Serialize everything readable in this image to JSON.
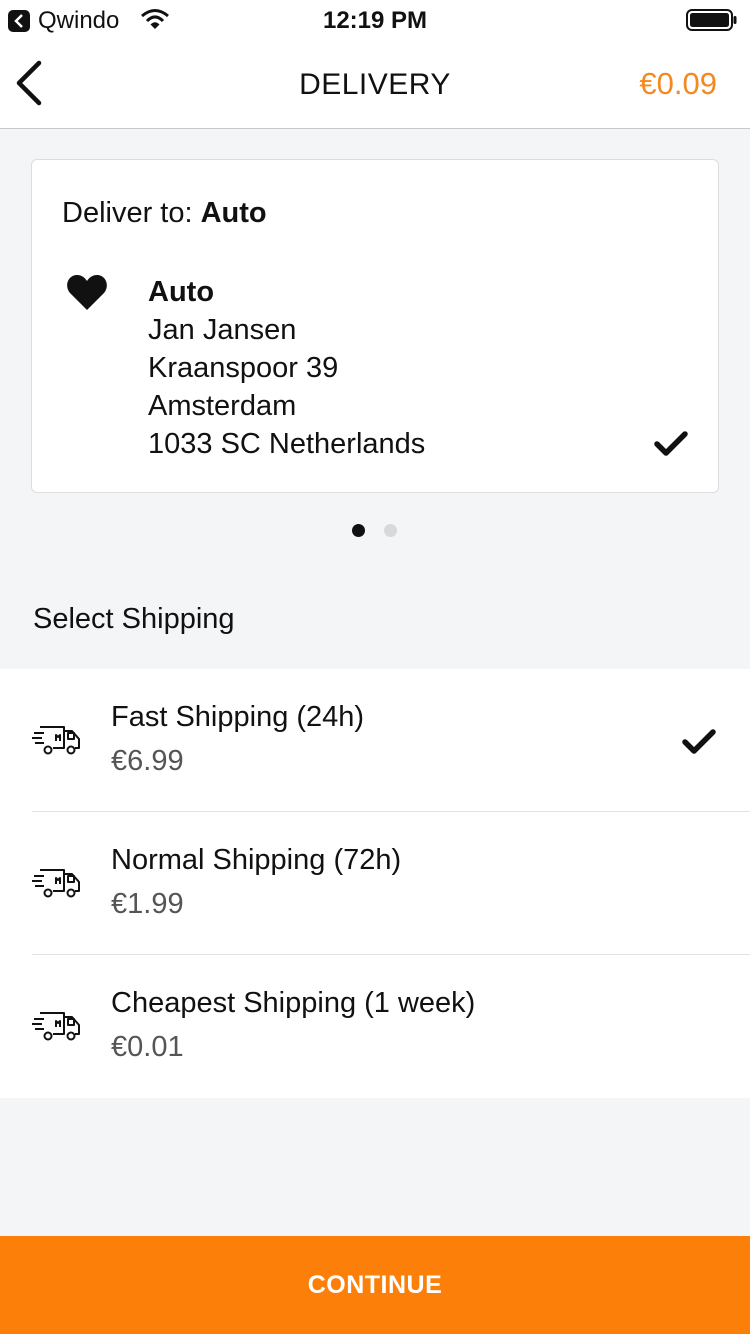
{
  "status_bar": {
    "app_name": "Qwindo",
    "time": "12:19 PM"
  },
  "nav": {
    "title": "DELIVERY",
    "total": "€0.09",
    "accent_color": "#f5891f"
  },
  "address_card": {
    "deliver_to_label": "Deliver to: ",
    "deliver_to_value": "Auto",
    "address": {
      "name": "Auto",
      "person": "Jan Jansen",
      "street": "Kraanspoor 39",
      "city": "Amsterdam",
      "postal_country": "1033 SC Netherlands"
    },
    "selected": true
  },
  "pager": {
    "pages": 2,
    "current": 1
  },
  "shipping": {
    "section_title": "Select Shipping",
    "options": [
      {
        "name": "Fast Shipping (24h)",
        "price": "€6.99",
        "selected": true
      },
      {
        "name": "Normal Shipping (72h)",
        "price": "€1.99",
        "selected": false
      },
      {
        "name": "Cheapest Shipping (1 week)",
        "price": "€0.01",
        "selected": false
      }
    ]
  },
  "continue_label": "CONTINUE",
  "colors": {
    "button": "#fb7f09",
    "background": "#f4f5f7"
  }
}
